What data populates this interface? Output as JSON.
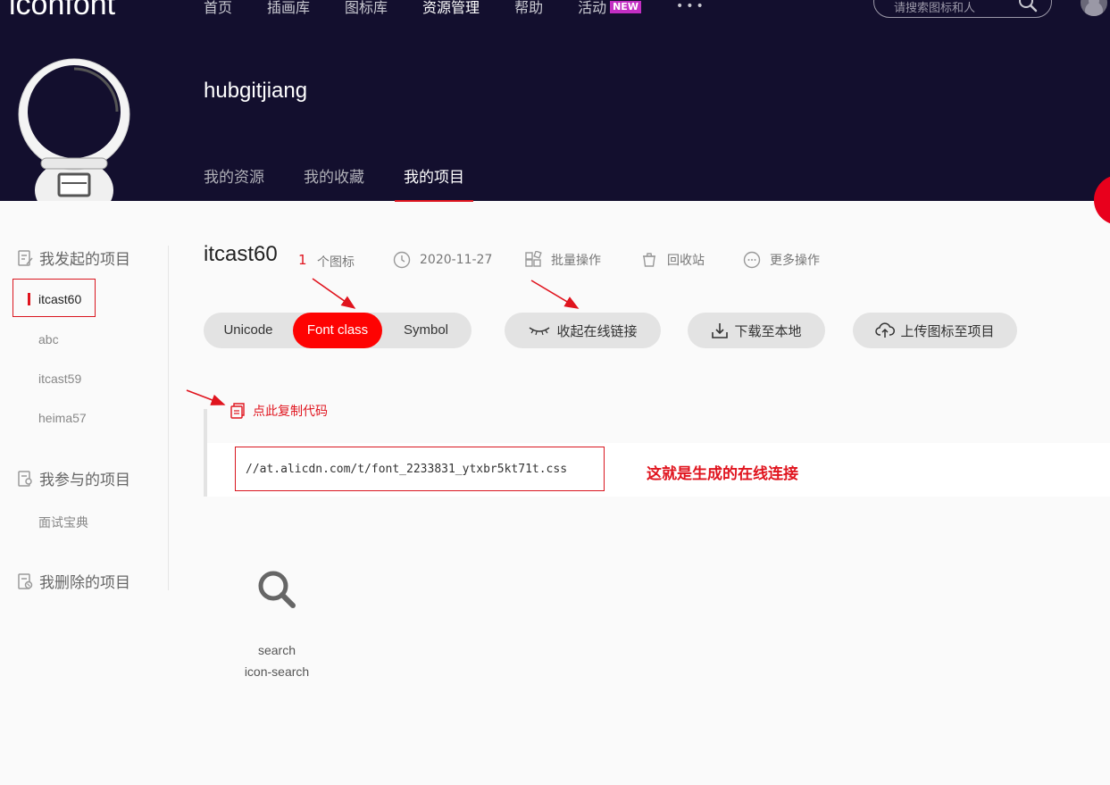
{
  "header": {
    "logo": "iconfont",
    "logo_mark": "°",
    "nav": [
      "首页",
      "插画库",
      "图标库",
      "资源管理",
      "帮助",
      "活动"
    ],
    "new_badge": "NEW",
    "more": "•••",
    "search": {
      "placeholder": "请搜索图标和人"
    },
    "colors": {
      "bg": "#130f2e",
      "accent": "#e0141e"
    }
  },
  "profile": {
    "username": "hubgitjiang",
    "tabs": [
      "我的资源",
      "我的收藏",
      "我的项目"
    ]
  },
  "sidebar": {
    "initiated": {
      "title": "我发起的项目",
      "items": [
        "itcast60",
        "abc",
        "itcast59",
        "heima57"
      ],
      "active": "itcast60"
    },
    "participated": {
      "title": "我参与的项目",
      "items": [
        "面试宝典"
      ]
    },
    "deleted": {
      "title": "我删除的项目"
    }
  },
  "project": {
    "name": "itcast60",
    "icon_count": "1",
    "icon_count_label": "个图标",
    "date": "2020-11-27",
    "actions": [
      "批量操作",
      "回收站",
      "更多操作"
    ]
  },
  "toolbar": {
    "modes": [
      "Unicode",
      "Font class",
      "Symbol"
    ],
    "active_mode": "Font class",
    "collapse_link": "收起在线链接",
    "download": "下载至本地",
    "upload": "上传图标至项目"
  },
  "code": {
    "copy_label": "点此复制代码",
    "url": "//at.alicdn.com/t/font_2233831_ytxbr5kt71t.css",
    "annotation": "这就是生成的在线连接"
  },
  "icons": [
    {
      "name": "search",
      "class": "icon-search",
      "icon": "search-icon"
    }
  ]
}
